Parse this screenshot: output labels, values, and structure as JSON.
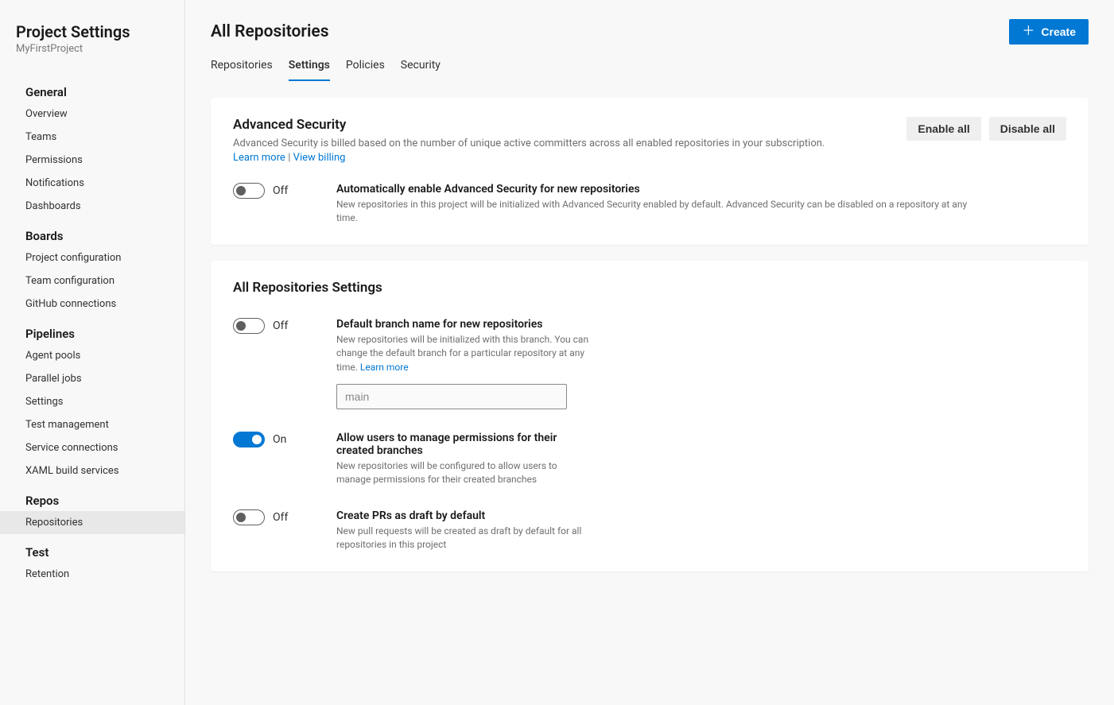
{
  "sidebar": {
    "title": "Project Settings",
    "subtitle": "MyFirstProject",
    "sections": [
      {
        "header": "General",
        "items": [
          "Overview",
          "Teams",
          "Permissions",
          "Notifications",
          "Dashboards"
        ]
      },
      {
        "header": "Boards",
        "items": [
          "Project configuration",
          "Team configuration",
          "GitHub connections"
        ]
      },
      {
        "header": "Pipelines",
        "items": [
          "Agent pools",
          "Parallel jobs",
          "Settings",
          "Test management",
          "Service connections",
          "XAML build services"
        ]
      },
      {
        "header": "Repos",
        "items": [
          "Repositories"
        ]
      },
      {
        "header": "Test",
        "items": [
          "Retention"
        ]
      }
    ],
    "active_item": "Repositories"
  },
  "page": {
    "title": "All Repositories",
    "create_button": "Create"
  },
  "tabs": [
    {
      "label": "Repositories",
      "active": false
    },
    {
      "label": "Settings",
      "active": true
    },
    {
      "label": "Policies",
      "active": false
    },
    {
      "label": "Security",
      "active": false
    }
  ],
  "advanced_security": {
    "title": "Advanced Security",
    "desc": "Advanced Security is billed based on the number of unique active committers across all enabled repositories in your subscription.",
    "learn_more": "Learn more",
    "view_billing": "View billing",
    "enable_all": "Enable all",
    "disable_all": "Disable all",
    "auto_enable": {
      "state": "Off",
      "title": "Automatically enable Advanced Security for new repositories",
      "desc": "New repositories in this project will be initialized with Advanced Security enabled by default. Advanced Security can be disabled on a repository at any time."
    }
  },
  "all_settings": {
    "title": "All Repositories Settings",
    "default_branch": {
      "state": "Off",
      "title": "Default branch name for new repositories",
      "desc": "New repositories will be initialized with this branch. You can change the default branch for a particular repository at any time. ",
      "learn_more": "Learn more",
      "placeholder": "main",
      "value": ""
    },
    "manage_permissions": {
      "state": "On",
      "title": "Allow users to manage permissions for their created branches",
      "desc": "New repositories will be configured to allow users to manage permissions for their created branches"
    },
    "draft_prs": {
      "state": "Off",
      "title": "Create PRs as draft by default",
      "desc": "New pull requests will be created as draft by default for all repositories in this project"
    }
  }
}
